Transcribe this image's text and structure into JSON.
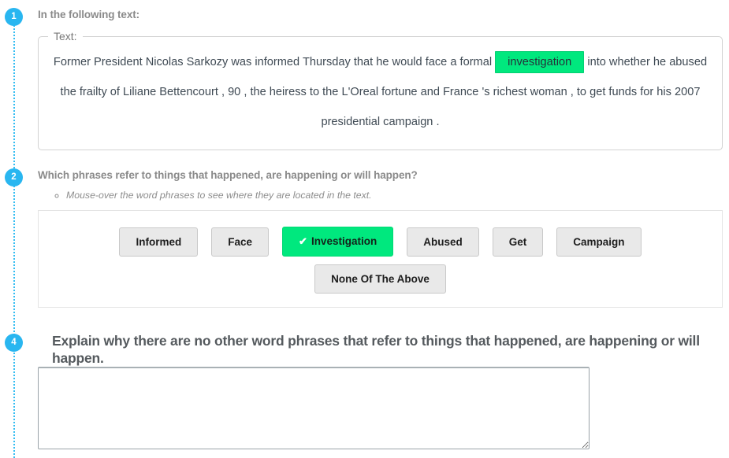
{
  "steps": [
    {
      "number": "1"
    },
    {
      "number": "2"
    },
    {
      "number": "4"
    }
  ],
  "section1": {
    "heading": "In the following text:",
    "fieldset_legend": "Text:",
    "passage_before": "Former President Nicolas Sarkozy was informed Thursday that he would face a formal",
    "passage_highlight": "investigation",
    "passage_after": "into whether he abused the frailty of Liliane Bettencourt , 90 , the heiress to the L'Oreal fortune and France 's richest woman , to get funds for his 2007 presidential campaign ."
  },
  "section2": {
    "heading": "Which phrases refer to things that happened, are happening or will happen?",
    "hint": "Mouse-over the word phrases to see where they are located in the text.",
    "choices_row1": [
      {
        "label": "Informed",
        "selected": false
      },
      {
        "label": "Face",
        "selected": false
      },
      {
        "label": "Investigation",
        "selected": true
      },
      {
        "label": "Abused",
        "selected": false
      },
      {
        "label": "Get",
        "selected": false
      },
      {
        "label": "Campaign",
        "selected": false
      }
    ],
    "choices_row2": [
      {
        "label": "None Of The Above",
        "selected": false
      }
    ],
    "check_glyph": "✔"
  },
  "section4": {
    "heading": "Explain why there are no other word phrases that refer to things that happened, are happening or will happen.",
    "textarea_value": "",
    "textarea_placeholder": ""
  },
  "colors": {
    "accent_blue": "#29b6f0",
    "highlight_green": "#00e87e",
    "button_gray": "#e9e9e9",
    "text_dark": "#3f4a54"
  }
}
